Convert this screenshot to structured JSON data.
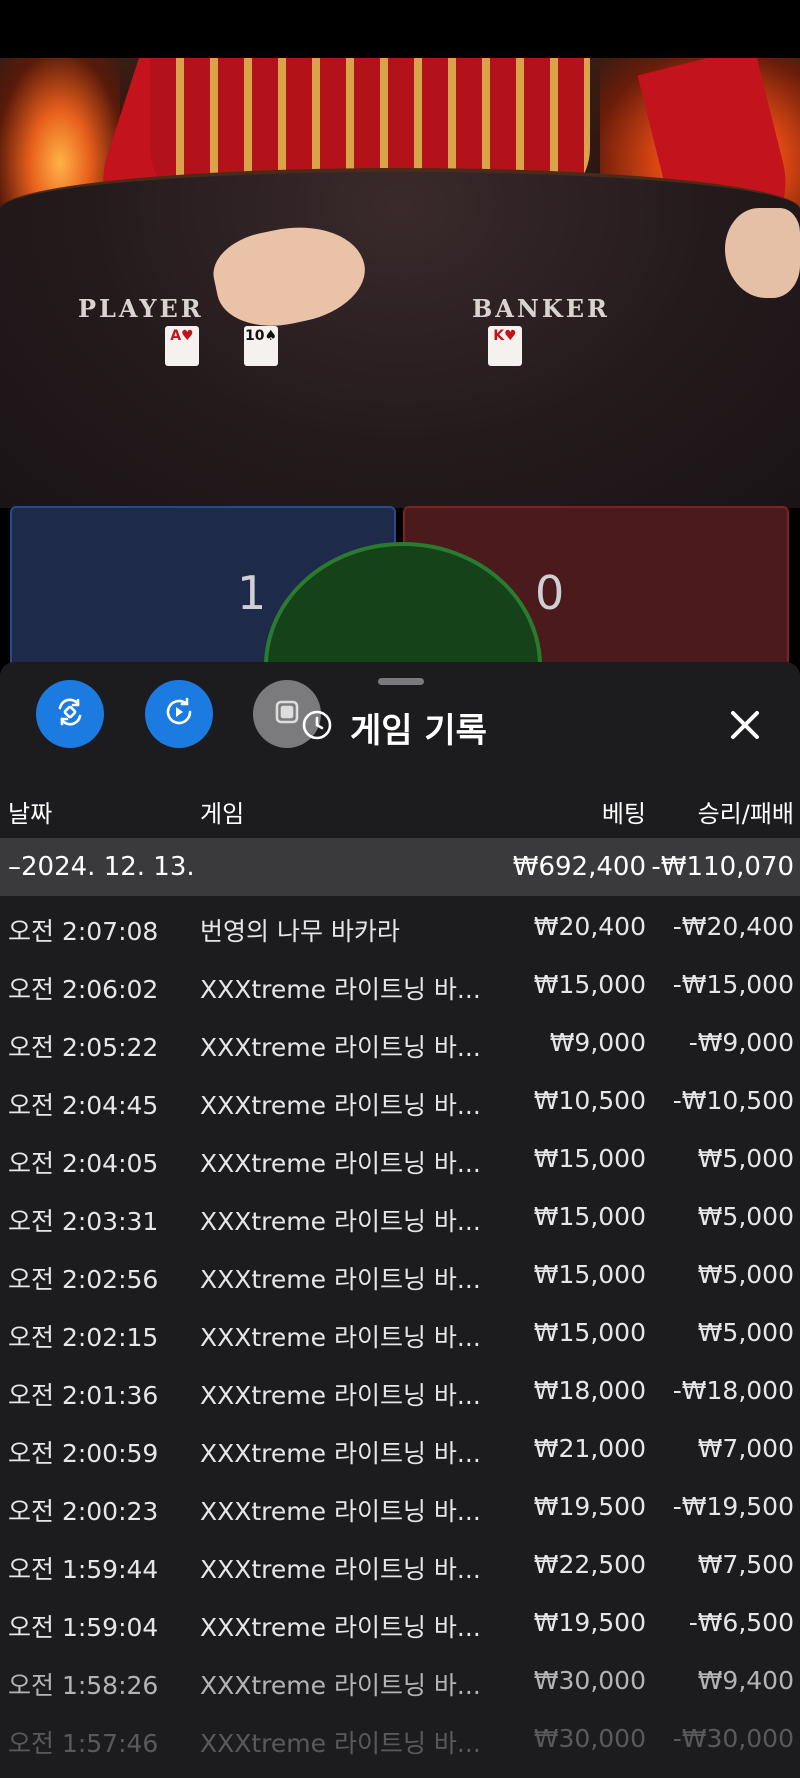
{
  "video": {
    "player_label": "PLAYER",
    "banker_label": "BANKER",
    "player_cards": [
      {
        "rank": "A",
        "suit": "♥"
      },
      {
        "rank": "10",
        "suit": "♠"
      }
    ],
    "banker_cards": [
      {
        "rank": "K",
        "suit": "♥"
      }
    ]
  },
  "bet_area": {
    "player_count": "1",
    "banker_count": "0"
  },
  "sheet": {
    "title": "게임 기록",
    "buttons": [
      "rotate-icon",
      "replay-icon",
      "stop-icon"
    ],
    "columns": {
      "date": "날짜",
      "game": "게임",
      "bet": "베팅",
      "result": "승리/패배"
    },
    "summary": {
      "date": "–2024. 12. 13.",
      "bet": "₩692,400",
      "result": "-₩110,070"
    },
    "rows": [
      {
        "time": "오전 2:07:08",
        "game": "번영의 나무 바카라",
        "bet": "₩20,400",
        "result": "-₩20,400"
      },
      {
        "time": "오전 2:06:02",
        "game": "XXXtreme 라이트닝 바...",
        "bet": "₩15,000",
        "result": "-₩15,000"
      },
      {
        "time": "오전 2:05:22",
        "game": "XXXtreme 라이트닝 바...",
        "bet": "₩9,000",
        "result": "-₩9,000"
      },
      {
        "time": "오전 2:04:45",
        "game": "XXXtreme 라이트닝 바...",
        "bet": "₩10,500",
        "result": "-₩10,500"
      },
      {
        "time": "오전 2:04:05",
        "game": "XXXtreme 라이트닝 바...",
        "bet": "₩15,000",
        "result": "₩5,000"
      },
      {
        "time": "오전 2:03:31",
        "game": "XXXtreme 라이트닝 바...",
        "bet": "₩15,000",
        "result": "₩5,000"
      },
      {
        "time": "오전 2:02:56",
        "game": "XXXtreme 라이트닝 바...",
        "bet": "₩15,000",
        "result": "₩5,000"
      },
      {
        "time": "오전 2:02:15",
        "game": "XXXtreme 라이트닝 바...",
        "bet": "₩15,000",
        "result": "₩5,000"
      },
      {
        "time": "오전 2:01:36",
        "game": "XXXtreme 라이트닝 바...",
        "bet": "₩18,000",
        "result": "-₩18,000"
      },
      {
        "time": "오전 2:00:59",
        "game": "XXXtreme 라이트닝 바...",
        "bet": "₩21,000",
        "result": "₩7,000"
      },
      {
        "time": "오전 2:00:23",
        "game": "XXXtreme 라이트닝 바...",
        "bet": "₩19,500",
        "result": "-₩19,500"
      },
      {
        "time": "오전 1:59:44",
        "game": "XXXtreme 라이트닝 바...",
        "bet": "₩22,500",
        "result": "₩7,500"
      },
      {
        "time": "오전 1:59:04",
        "game": "XXXtreme 라이트닝 바...",
        "bet": "₩19,500",
        "result": "-₩6,500"
      },
      {
        "time": "오전 1:58:26",
        "game": "XXXtreme 라이트닝 바...",
        "bet": "₩30,000",
        "result": "₩9,400"
      },
      {
        "time": "오전 1:57:46",
        "game": "XXXtreme 라이트닝 바...",
        "bet": "₩30,000",
        "result": "-₩30,000"
      }
    ]
  }
}
